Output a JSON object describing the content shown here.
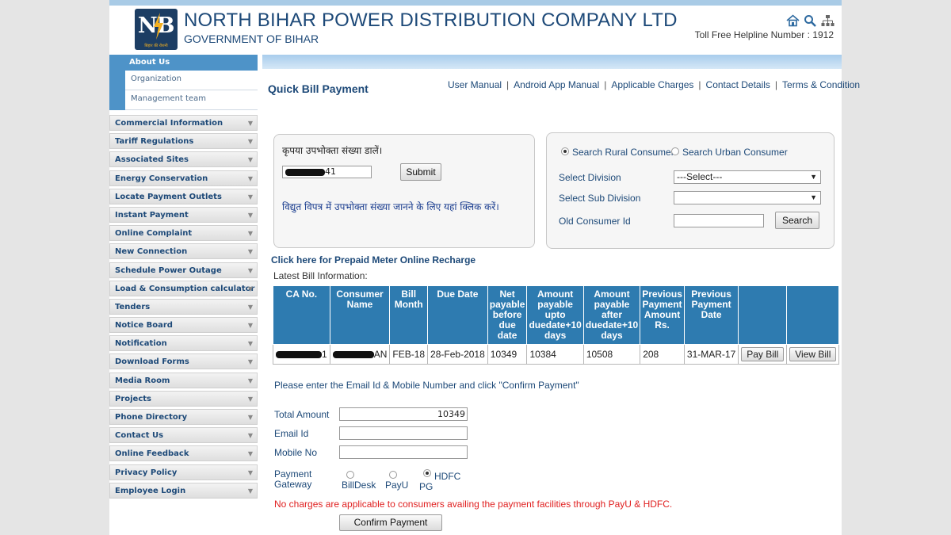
{
  "header": {
    "logo_text": "NB",
    "logo_tagline": "बिहार की रोशनी",
    "company": "NORTH BIHAR POWER DISTRIBUTION COMPANY LTD",
    "government": "GOVERNMENT OF BIHAR",
    "helpline": "Toll Free Helpline Number : 1912",
    "icons": [
      "home-icon",
      "search-icon",
      "sitemap-icon"
    ]
  },
  "sidebar": {
    "about": "About Us",
    "about_sub": [
      "Organization",
      "Management team"
    ],
    "items": [
      "Commercial Information",
      "Tariff Regulations",
      "Associated Sites",
      "Energy Conservation",
      "Locate Payment Outlets",
      "Instant Payment",
      "Online Complaint",
      "New Connection",
      "Schedule Power Outage",
      "Load & Consumption calculator",
      "Tenders",
      "Notice Board",
      "Notification",
      "Download Forms",
      "Media Room",
      "Projects",
      "Phone Directory",
      "Contact Us",
      "Online Feedback",
      "Privacy Policy",
      "Employee Login"
    ]
  },
  "main": {
    "title": "Quick Bill Payment",
    "links": [
      "User Manual",
      "Android App Manual",
      "Applicable Charges",
      "Contact Details",
      "Terms & Condition"
    ],
    "left_box": {
      "prompt": "कृपया उपभोक्ता संख्या डालें।",
      "consumer_value_suffix": "41",
      "submit": "Submit",
      "hint": "विद्युत विपत्र में उपभोक्ता संख्या जानने के लिए यहां क्लिक करें।"
    },
    "right_box": {
      "rural": "Search Rural Consumer",
      "urban": "Search Urban Consumer",
      "division_label": "Select Division",
      "division_value": "---Select---",
      "subdivision_label": "Select Sub Division",
      "subdivision_value": "",
      "old_id_label": "Old Consumer Id",
      "search": "Search"
    },
    "prepaid_link": "Click here for Prepaid Meter Online Recharge",
    "latest_label": "Latest Bill Information:",
    "table": {
      "headers": [
        "CA No.",
        "Consumer Name",
        "Bill Month",
        "Due Date",
        "Net payable before due date",
        "Amount payable upto duedate+10 days",
        "Amount payable after duedate+10 days",
        "Previous Payment Amount Rs.",
        "Previous Payment Date",
        "",
        ""
      ],
      "row": {
        "ca_suffix": "1",
        "name_suffix": "AN",
        "bill_month": "FEB-18",
        "due_date": "28-Feb-2018",
        "net_payable": "10349",
        "upto_10": "10384",
        "after_10": "10508",
        "prev_amount": "208",
        "prev_date": "31-MAR-17",
        "pay_bill": "Pay Bill",
        "view_bill": "View Bill"
      }
    },
    "payment": {
      "instruction": "Please enter the Email Id & Mobile Number and click \"Confirm Payment\"",
      "total_label": "Total Amount",
      "total_value": "10349",
      "email_label": "Email Id",
      "mobile_label": "Mobile No",
      "gateway_label_1": "Payment",
      "gateway_label_2": "Gateway",
      "gateways": [
        "BillDesk",
        "PayU",
        "PG"
      ],
      "hdfc": "HDFC",
      "selected_gateway": "HDFC",
      "notice": "No charges are applicable to consumers availing the payment facilities through PayU & HDFC.",
      "confirm": "Confirm Payment"
    }
  }
}
